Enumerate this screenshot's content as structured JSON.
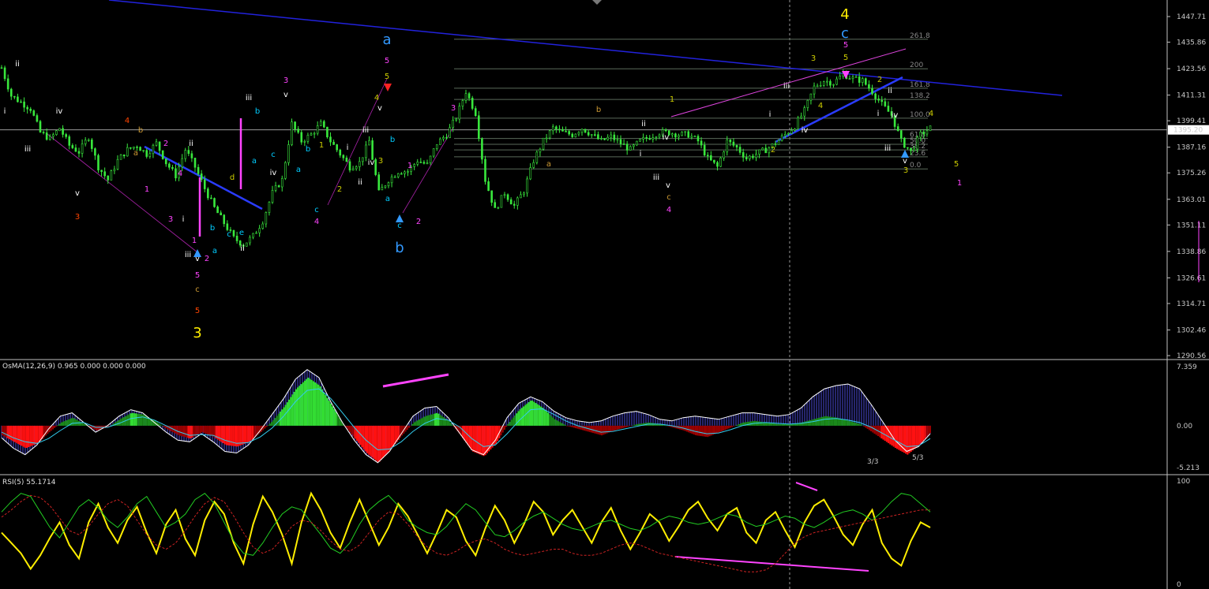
{
  "chart_data": [
    {
      "type": "line",
      "panel": "main-price-candles",
      "ylim": [
        1290.56,
        1447.71
      ],
      "price_ticks": [
        "1447.71",
        "1435.86",
        "1423.56",
        "1411.31",
        "1399.41",
        "1387.16",
        "1375.26",
        "1363.01",
        "1351.11",
        "1338.86",
        "1326.61",
        "1314.71",
        "1302.46",
        "1290.56"
      ],
      "current_price_label": "1395.20",
      "current_price": 1395.2,
      "close_path": [
        1424,
        1411,
        1408,
        1405,
        1394,
        1391,
        1396,
        1388,
        1385,
        1392,
        1378,
        1372,
        1381,
        1386,
        1388,
        1384,
        1389,
        1380,
        1374,
        1386,
        1378,
        1368,
        1359,
        1352,
        1345,
        1342,
        1346,
        1353,
        1366,
        1372,
        1398,
        1390,
        1393,
        1398,
        1390,
        1384,
        1378,
        1380,
        1390,
        1366,
        1372,
        1376,
        1376,
        1381,
        1379,
        1389,
        1393,
        1401,
        1413,
        1403,
        1372,
        1358,
        1366,
        1360,
        1367,
        1381,
        1390,
        1396,
        1394,
        1393,
        1396,
        1393,
        1390,
        1392,
        1389,
        1386,
        1390,
        1392,
        1394,
        1394,
        1393,
        1393,
        1390,
        1382,
        1378,
        1390,
        1387,
        1382,
        1384,
        1386,
        1389,
        1393,
        1397,
        1404,
        1415,
        1418,
        1417,
        1421,
        1419,
        1418,
        1413,
        1407,
        1402,
        1390,
        1385,
        1393,
        1396
      ],
      "fib_levels": [
        {
          "label": "261.8",
          "price": 1437.2
        },
        {
          "label": "200",
          "price": 1423.5
        },
        {
          "label": "161.8",
          "price": 1414.5
        },
        {
          "label": "138.2",
          "price": 1409.3
        },
        {
          "label": "100.0",
          "price": 1400.6
        },
        {
          "label": "61.8",
          "price": 1391.2
        },
        {
          "label": "50.0",
          "price": 1388.5
        },
        {
          "label": "38.2",
          "price": 1385.9
        },
        {
          "label": "23.6",
          "price": 1382.7
        },
        {
          "label": "0.0",
          "price": 1377.1
        }
      ],
      "wave_labels": [
        {
          "t": "ii",
          "c": "#ffffff",
          "big": false
        },
        {
          "t": "i",
          "c": "#ffffff",
          "big": false
        },
        {
          "t": "iii",
          "c": "#ffffff",
          "big": false
        },
        {
          "t": "iv",
          "c": "#ffffff",
          "big": false
        },
        {
          "t": "v",
          "c": "#ffffff",
          "big": false
        },
        {
          "t": "3",
          "c": "#ff4400",
          "big": false
        },
        {
          "t": "4",
          "c": "#ff4400",
          "big": false
        },
        {
          "t": "b",
          "c": "#cc9933",
          "big": false
        },
        {
          "t": "a",
          "c": "#cc9933",
          "big": false
        },
        {
          "t": "2",
          "c": "#ff44ff",
          "big": false
        },
        {
          "t": "1",
          "c": "#ff44ff",
          "big": false
        },
        {
          "t": "3",
          "c": "#ff44ff",
          "big": false
        },
        {
          "t": "4",
          "c": "#ff44ff",
          "big": false
        },
        {
          "t": "ii",
          "c": "#ffffff",
          "big": false
        },
        {
          "t": "i",
          "c": "#ffffff",
          "big": false
        },
        {
          "t": "1",
          "c": "#ff44ff",
          "big": false
        },
        {
          "t": "iii",
          "c": "#ffffff",
          "big": false
        },
        {
          "t": "v",
          "c": "#ffffff",
          "big": false
        },
        {
          "t": "2",
          "c": "#ff44ff",
          "big": false
        },
        {
          "t": "5",
          "c": "#ff44ff",
          "big": false
        },
        {
          "t": "c",
          "c": "#cc9933",
          "big": false
        },
        {
          "t": "5",
          "c": "#ff4400",
          "big": false
        },
        {
          "t": "3",
          "c": "#ffee00",
          "big": true
        },
        {
          "t": "a",
          "c": "#00ccff",
          "big": false
        },
        {
          "t": "b",
          "c": "#00ccff",
          "big": false
        },
        {
          "t": "c",
          "c": "#00ccff",
          "big": false
        },
        {
          "t": "d",
          "c": "#cccc00",
          "big": false
        },
        {
          "t": "e",
          "c": "#00ccff",
          "big": false
        },
        {
          "t": "ii",
          "c": "#ffffff",
          "big": false
        },
        {
          "t": "iii",
          "c": "#ffffff",
          "big": false
        },
        {
          "t": "b",
          "c": "#00ccff",
          "big": false
        },
        {
          "t": "a",
          "c": "#00ccff",
          "big": false
        },
        {
          "t": "v",
          "c": "#ffffff",
          "big": false
        },
        {
          "t": "c",
          "c": "#00ccff",
          "big": false
        },
        {
          "t": "3",
          "c": "#ff44ff",
          "big": false
        },
        {
          "t": "iv",
          "c": "#ffffff",
          "big": false
        },
        {
          "t": "a",
          "c": "#00ccff",
          "big": false
        },
        {
          "t": "b",
          "c": "#00ccff",
          "big": false
        },
        {
          "t": "1",
          "c": "#cccc00",
          "big": false
        },
        {
          "t": "c",
          "c": "#00ccff",
          "big": false
        },
        {
          "t": "4",
          "c": "#ff44ff",
          "big": false
        },
        {
          "t": "i",
          "c": "#ffffff",
          "big": false
        },
        {
          "t": "ii",
          "c": "#ffffff",
          "big": false
        },
        {
          "t": "2",
          "c": "#cccc00",
          "big": false
        },
        {
          "t": "iii",
          "c": "#ffffff",
          "big": false
        },
        {
          "t": "iv",
          "c": "#ffffff",
          "big": false
        },
        {
          "t": "v",
          "c": "#ffffff",
          "big": false
        },
        {
          "t": "3",
          "c": "#cccc00",
          "big": false
        },
        {
          "t": "4",
          "c": "#cccc00",
          "big": false
        },
        {
          "t": "5",
          "c": "#ff44ff",
          "big": false
        },
        {
          "t": "5",
          "c": "#cccc00",
          "big": false
        },
        {
          "t": "a",
          "c": "#3399ff",
          "big": true
        },
        {
          "t": "b",
          "c": "#00ccff",
          "big": false
        },
        {
          "t": "a",
          "c": "#00ccff",
          "big": false
        },
        {
          "t": "1",
          "c": "#ff44ff",
          "big": false
        },
        {
          "t": "c",
          "c": "#00ccff",
          "big": false
        },
        {
          "t": "2",
          "c": "#ff44ff",
          "big": false
        },
        {
          "t": "b",
          "c": "#3399ff",
          "big": true
        },
        {
          "t": "3",
          "c": "#ff44ff",
          "big": false
        },
        {
          "t": "a",
          "c": "#cc9933",
          "big": false
        },
        {
          "t": "b",
          "c": "#cc9933",
          "big": false
        },
        {
          "t": "1",
          "c": "#cccc00",
          "big": false
        },
        {
          "t": "ii",
          "c": "#ffffff",
          "big": false
        },
        {
          "t": "i",
          "c": "#ffffff",
          "big": false
        },
        {
          "t": "iv",
          "c": "#ffffff",
          "big": false
        },
        {
          "t": "iii",
          "c": "#ffffff",
          "big": false
        },
        {
          "t": "v",
          "c": "#ffffff",
          "big": false
        },
        {
          "t": "c",
          "c": "#cc9933",
          "big": false
        },
        {
          "t": "4",
          "c": "#ff44ff",
          "big": false
        },
        {
          "t": "i",
          "c": "#ffffff",
          "big": false
        },
        {
          "t": "2",
          "c": "#cccc00",
          "big": false
        },
        {
          "t": "iii",
          "c": "#ffffff",
          "big": false
        },
        {
          "t": "iv",
          "c": "#ffffff",
          "big": false
        },
        {
          "t": "3",
          "c": "#cccc00",
          "big": false
        },
        {
          "t": "4",
          "c": "#cccc00",
          "big": false
        },
        {
          "t": "5",
          "c": "#cccc00",
          "big": false
        },
        {
          "t": "5",
          "c": "#ff44ff",
          "big": false
        },
        {
          "t": "c",
          "c": "#3399ff",
          "big": true
        },
        {
          "t": "4",
          "c": "#ffee00",
          "big": true
        },
        {
          "t": "2",
          "c": "#cccc00",
          "big": false
        },
        {
          "t": "i",
          "c": "#ffffff",
          "big": false
        },
        {
          "t": "ii",
          "c": "#ffffff",
          "big": false
        },
        {
          "t": "iii",
          "c": "#ffffff",
          "big": false
        },
        {
          "t": "iv",
          "c": "#ffffff",
          "big": false
        },
        {
          "t": "v",
          "c": "#ffffff",
          "big": false
        },
        {
          "t": "3",
          "c": "#cccc00",
          "big": false
        },
        {
          "t": "4",
          "c": "#cccc00",
          "big": false
        },
        {
          "t": "5",
          "c": "#cccc00",
          "big": false
        },
        {
          "t": "1",
          "c": "#ff44ff",
          "big": false
        }
      ]
    },
    {
      "type": "bar",
      "panel": "osma",
      "title": "OsMA(12,26,9) 0.965 0.000 0.000 0.000",
      "ylim": [
        -5.213,
        7.359
      ],
      "ticks": [
        "7.359",
        "0.00",
        "-5.213"
      ],
      "annotations": [
        "3/3",
        "5/3"
      ],
      "values": [
        -1.2,
        -2.0,
        -2.8,
        -2.2,
        -0.8,
        0.4,
        1.0,
        0.2,
        -0.6,
        -0.2,
        0.8,
        1.6,
        1.4,
        0.6,
        -0.4,
        -1.2,
        -1.6,
        -0.8,
        -1.4,
        -2.4,
        -2.6,
        -2.0,
        -0.8,
        0.6,
        2.4,
        4.6,
        6.0,
        5.0,
        2.6,
        0.2,
        -1.6,
        -3.4,
        -4.6,
        -3.0,
        -1.2,
        0.4,
        1.2,
        1.6,
        0.6,
        -1.2,
        -3.2,
        -3.8,
        -2.2,
        0.2,
        2.0,
        3.2,
        2.2,
        0.8,
        0.0,
        -0.4,
        -0.8,
        -1.2,
        -0.6,
        -0.2,
        0.2,
        0.4,
        0.2,
        -0.2,
        -0.6,
        -1.2,
        -1.4,
        -0.8,
        -0.2,
        0.4,
        0.6,
        0.4,
        0.2,
        0.2,
        0.4,
        0.8,
        1.2,
        1.0,
        0.6,
        0.2,
        -0.8,
        -1.8,
        -2.8,
        -3.6,
        -2.4,
        -0.8
      ],
      "signal": [
        -0.8,
        -1.5,
        -2.0,
        -2.2,
        -1.6,
        -0.6,
        0.3,
        0.4,
        -0.2,
        -0.2,
        0.3,
        0.9,
        1.1,
        0.7,
        0.0,
        -0.7,
        -1.2,
        -1.1,
        -1.2,
        -1.8,
        -2.2,
        -2.1,
        -1.4,
        -0.3,
        1.2,
        3.0,
        4.4,
        4.6,
        3.4,
        1.6,
        -0.2,
        -1.8,
        -3.0,
        -2.9,
        -2.0,
        -0.7,
        0.3,
        0.9,
        0.7,
        -0.2,
        -1.6,
        -2.6,
        -2.4,
        -1.0,
        0.6,
        2.0,
        2.1,
        1.4,
        0.6,
        0.0,
        -0.4,
        -0.8,
        -0.7,
        -0.4,
        -0.1,
        0.2,
        0.2,
        0.0,
        -0.3,
        -0.7,
        -1.0,
        -0.9,
        -0.5,
        0.0,
        0.3,
        0.4,
        0.3,
        0.2,
        0.3,
        0.5,
        0.8,
        0.9,
        0.7,
        0.4,
        -0.2,
        -1.0,
        -1.8,
        -2.6,
        -2.5,
        -1.6
      ],
      "macd_envelope": [
        -1.5,
        -2.8,
        -3.6,
        -2.4,
        -0.4,
        1.2,
        1.6,
        0.4,
        -0.8,
        0.0,
        1.2,
        2.0,
        1.6,
        0.4,
        -0.8,
        -1.8,
        -2.0,
        -1.0,
        -2.0,
        -3.2,
        -3.4,
        -2.4,
        -0.6,
        1.4,
        3.4,
        5.8,
        7.0,
        6.0,
        3.0,
        0.4,
        -1.8,
        -3.6,
        -4.6,
        -3.2,
        -1.0,
        1.2,
        2.2,
        2.4,
        1.0,
        -1.0,
        -3.0,
        -3.6,
        -1.8,
        1.0,
        2.8,
        3.6,
        3.0,
        1.8,
        1.0,
        0.6,
        0.4,
        0.6,
        1.2,
        1.6,
        1.8,
        1.4,
        0.8,
        0.6,
        1.0,
        1.2,
        1.0,
        0.8,
        1.2,
        1.6,
        1.6,
        1.4,
        1.2,
        1.4,
        2.2,
        3.6,
        4.6,
        5.0,
        5.2,
        4.6,
        2.6,
        0.4,
        -1.8,
        -3.2,
        -2.6,
        -1.0
      ]
    },
    {
      "type": "line",
      "panel": "rsi",
      "title": "RSI(5) 55.1714",
      "ylim": [
        0,
        100
      ],
      "ticks": [
        "100",
        "0"
      ],
      "series": [
        {
          "values": [
            50,
            40,
            30,
            15,
            28,
            45,
            60,
            38,
            25,
            60,
            78,
            55,
            40,
            62,
            75,
            50,
            30,
            58,
            72,
            44,
            28,
            62,
            80,
            68,
            40,
            20,
            58,
            85,
            70,
            48,
            20,
            60,
            88,
            72,
            50,
            35,
            60,
            82,
            60,
            38,
            55,
            78,
            66,
            48,
            30,
            50,
            72,
            65,
            42,
            28,
            54,
            76,
            62,
            40,
            58,
            80,
            70,
            48,
            62,
            72,
            56,
            40,
            60,
            74,
            52,
            34,
            50,
            68,
            60,
            42,
            56,
            72,
            80,
            64,
            52,
            68,
            74,
            50,
            40,
            62,
            70,
            52,
            36,
            60,
            76,
            82,
            66,
            48,
            38,
            58,
            72,
            40,
            25,
            18,
            42,
            60,
            55
          ]
        },
        {
          "values": [
            70,
            80,
            88,
            85,
            70,
            55,
            45,
            60,
            75,
            82,
            74,
            62,
            55,
            65,
            78,
            85,
            70,
            55,
            60,
            68,
            82,
            88,
            78,
            60,
            42,
            30,
            28,
            40,
            55,
            68,
            75,
            72,
            60,
            48,
            35,
            30,
            40,
            58,
            72,
            80,
            86,
            76,
            62,
            55,
            50,
            48,
            56,
            68,
            78,
            72,
            60,
            48,
            46,
            52,
            60,
            66,
            70,
            64,
            58,
            54,
            52,
            56,
            60,
            62,
            58,
            54,
            52,
            56,
            62,
            66,
            64,
            60,
            58,
            60,
            64,
            68,
            66,
            60,
            56,
            58,
            62,
            66,
            64,
            58,
            55,
            60,
            66,
            70,
            72,
            68,
            62,
            70,
            80,
            88,
            86,
            78,
            70
          ]
        },
        {
          "values": [
            65,
            72,
            80,
            86,
            84,
            76,
            64,
            52,
            48,
            56,
            68,
            78,
            82,
            76,
            62,
            48,
            38,
            34,
            40,
            52,
            66,
            78,
            84,
            80,
            66,
            50,
            36,
            30,
            34,
            44,
            56,
            62,
            60,
            52,
            42,
            34,
            32,
            38,
            50,
            62,
            70,
            68,
            58,
            46,
            36,
            30,
            28,
            32,
            38,
            42,
            44,
            40,
            34,
            30,
            28,
            30,
            32,
            34,
            34,
            30,
            28,
            28,
            30,
            34,
            38,
            40,
            38,
            34,
            30,
            28,
            26,
            24,
            22,
            20,
            18,
            16,
            14,
            12,
            12,
            14,
            20,
            30,
            40,
            46,
            50,
            52,
            54,
            56,
            58,
            60,
            62,
            64,
            66,
            68,
            70,
            72,
            72
          ]
        }
      ]
    }
  ]
}
